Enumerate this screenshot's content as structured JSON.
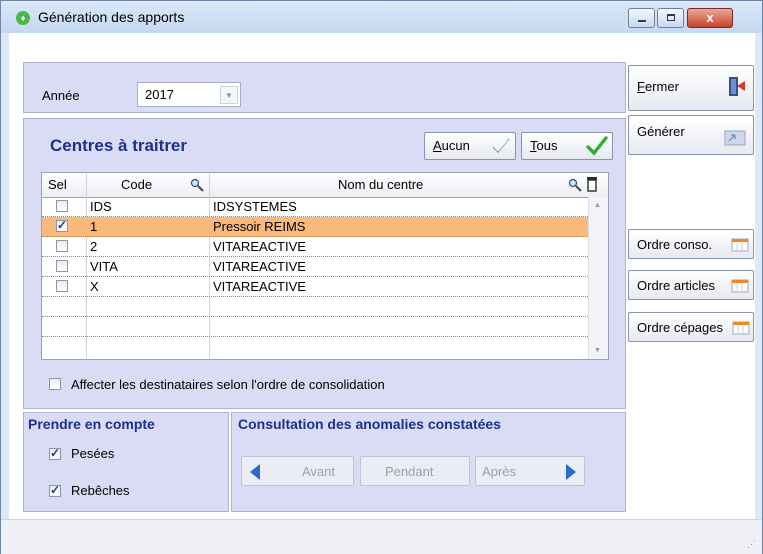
{
  "window": {
    "title": "Génération des apports",
    "close_glyph": "x"
  },
  "annee": {
    "label": "Année",
    "value": "2017"
  },
  "centres": {
    "title": "Centres à traitrer",
    "btn_aucun": {
      "underline": "A",
      "rest": "ucun"
    },
    "btn_tous": {
      "underline": "T",
      "rest": "ous"
    },
    "columns": {
      "sel": "Sel",
      "code": "Code",
      "nom": "Nom du centre"
    },
    "rows": [
      {
        "checked": false,
        "code": "IDS",
        "nom": "IDSYSTEMES",
        "selected": false
      },
      {
        "checked": true,
        "code": "1",
        "nom": "Pressoir REIMS",
        "selected": true
      },
      {
        "checked": false,
        "code": "2",
        "nom": "VITAREACTIVE",
        "selected": false
      },
      {
        "checked": false,
        "code": "VITA",
        "nom": "VITAREACTIVE",
        "selected": false
      },
      {
        "checked": false,
        "code": "X",
        "nom": "VITAREACTIVE",
        "selected": false
      }
    ],
    "affecter_label": "Affecter les destinataires selon l'ordre de consolidation"
  },
  "prendre": {
    "title": "Prendre en compte",
    "pesees": "Pesées",
    "rebeches": "Rebêches"
  },
  "consultation": {
    "title": "Consultation des anomalies constatées",
    "avant": "Avant",
    "pendant": "Pendant",
    "apres": "Après"
  },
  "side": {
    "fermer": {
      "underline": "F",
      "rest": "ermer"
    },
    "generer": "Générer",
    "ordre_conso": "Ordre conso.",
    "ordre_articles": "Ordre articles",
    "ordre_cepages": "Ordre cépages"
  },
  "colors": {
    "panel": "#d9dcf4",
    "selected_row": "#f9b97a",
    "section_title": "#1d2f8f",
    "nav_arrow": "#2a6bc9"
  }
}
